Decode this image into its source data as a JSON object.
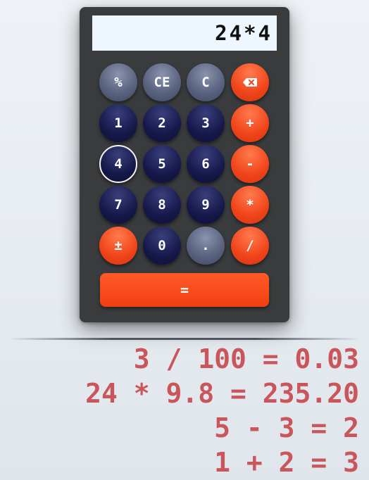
{
  "display": {
    "value": "24*4"
  },
  "keypad": {
    "percent": "%",
    "ce": "CE",
    "c": "C",
    "backspace_icon": "backspace-icon",
    "one": "1",
    "two": "2",
    "three": "3",
    "plus": "+",
    "four": "4",
    "five": "5",
    "six": "6",
    "minus": "-",
    "seven": "7",
    "eight": "8",
    "nine": "9",
    "multiply": "*",
    "plus_minus": "±",
    "zero": "0",
    "decimal": ".",
    "divide": "/",
    "equals": "="
  },
  "history": [
    "3 / 100 = 0.03",
    "24 * 9.8 = 235.20",
    "5 - 3 = 2",
    "1 + 2 = 3"
  ],
  "colors": {
    "display_bg": "#eef6ff",
    "body": "#3a3b3c",
    "accent": "#f0441a",
    "digit": "#16184a",
    "function": "#5a6480",
    "history_text": "#c9565a"
  }
}
